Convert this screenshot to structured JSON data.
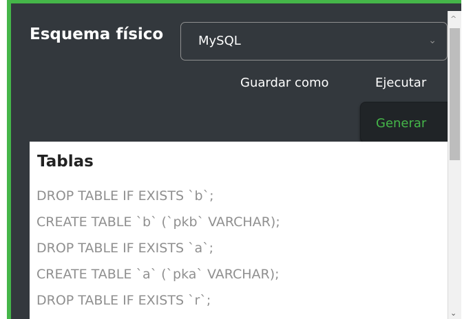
{
  "panel": {
    "title": "Esquema físico"
  },
  "engine_select": {
    "value": "MySQL",
    "caret": "⌄"
  },
  "actions": {
    "save_as": "Guardar como",
    "execute": "Ejecutar",
    "generate": "Generar"
  },
  "scrollbar": {
    "up": "^",
    "down": "⌄"
  },
  "output": {
    "title": "Tablas",
    "lines": [
      "DROP TABLE IF EXISTS `b`;",
      "CREATE TABLE `b` (`pkb` VARCHAR);",
      "DROP TABLE IF EXISTS `a`;",
      "CREATE TABLE `a` (`pka` VARCHAR);",
      "DROP TABLE IF EXISTS `r`;"
    ]
  },
  "colors": {
    "accent": "#45b649",
    "panel_background": "#33383d",
    "button_background": "#202427"
  }
}
